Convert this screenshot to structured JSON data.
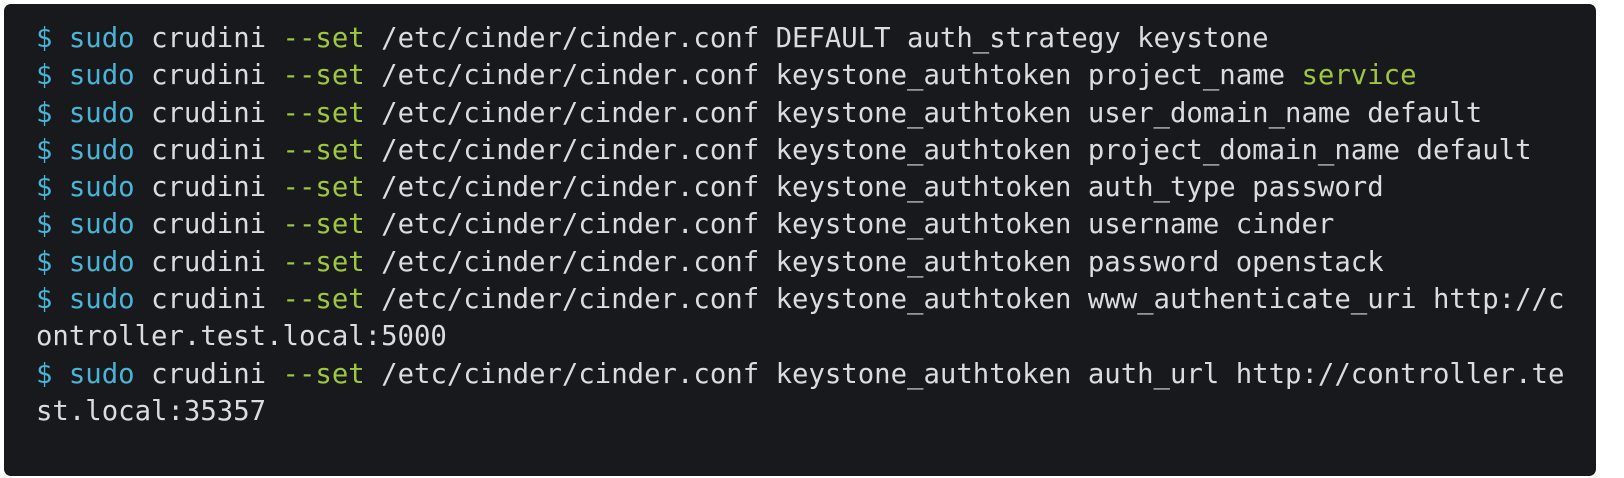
{
  "colors": {
    "background": "#17191c",
    "text": "#d9dce0",
    "prompt": "#4ab3d6",
    "keyword": "#4ab3d6",
    "flag": "#9fc63f",
    "highlight": "#9fc63f"
  },
  "lines": [
    {
      "prompt": "$",
      "cmd": "sudo",
      "tool": "crudini",
      "flag": "--set",
      "rest": "/etc/cinder/cinder.conf DEFAULT auth_strategy keystone",
      "highlight": ""
    },
    {
      "prompt": "$",
      "cmd": "sudo",
      "tool": "crudini",
      "flag": "--set",
      "rest": "/etc/cinder/cinder.conf keystone_authtoken project_name ",
      "highlight": "service"
    },
    {
      "prompt": "$",
      "cmd": "sudo",
      "tool": "crudini",
      "flag": "--set",
      "rest": "/etc/cinder/cinder.conf keystone_authtoken user_domain_name default",
      "highlight": ""
    },
    {
      "prompt": "$",
      "cmd": "sudo",
      "tool": "crudini",
      "flag": "--set",
      "rest": "/etc/cinder/cinder.conf keystone_authtoken project_domain_name default",
      "highlight": ""
    },
    {
      "prompt": "$",
      "cmd": "sudo",
      "tool": "crudini",
      "flag": "--set",
      "rest": "/etc/cinder/cinder.conf keystone_authtoken auth_type password",
      "highlight": ""
    },
    {
      "prompt": "$",
      "cmd": "sudo",
      "tool": "crudini",
      "flag": "--set",
      "rest": "/etc/cinder/cinder.conf keystone_authtoken username cinder",
      "highlight": ""
    },
    {
      "prompt": "$",
      "cmd": "sudo",
      "tool": "crudini",
      "flag": "--set",
      "rest": "/etc/cinder/cinder.conf keystone_authtoken password openstack",
      "highlight": ""
    },
    {
      "prompt": "$",
      "cmd": "sudo",
      "tool": "crudini",
      "flag": "--set",
      "rest": "/etc/cinder/cinder.conf keystone_authtoken www_authenticate_uri http://c",
      "highlight": ""
    },
    {
      "continuation": "ontroller.test.local:5000"
    },
    {
      "prompt": "$",
      "cmd": "sudo",
      "tool": "crudini",
      "flag": "--set",
      "rest": "/etc/cinder/cinder.conf keystone_authtoken auth_url http://controller.te",
      "highlight": ""
    },
    {
      "continuation": "st.local:35357"
    }
  ]
}
